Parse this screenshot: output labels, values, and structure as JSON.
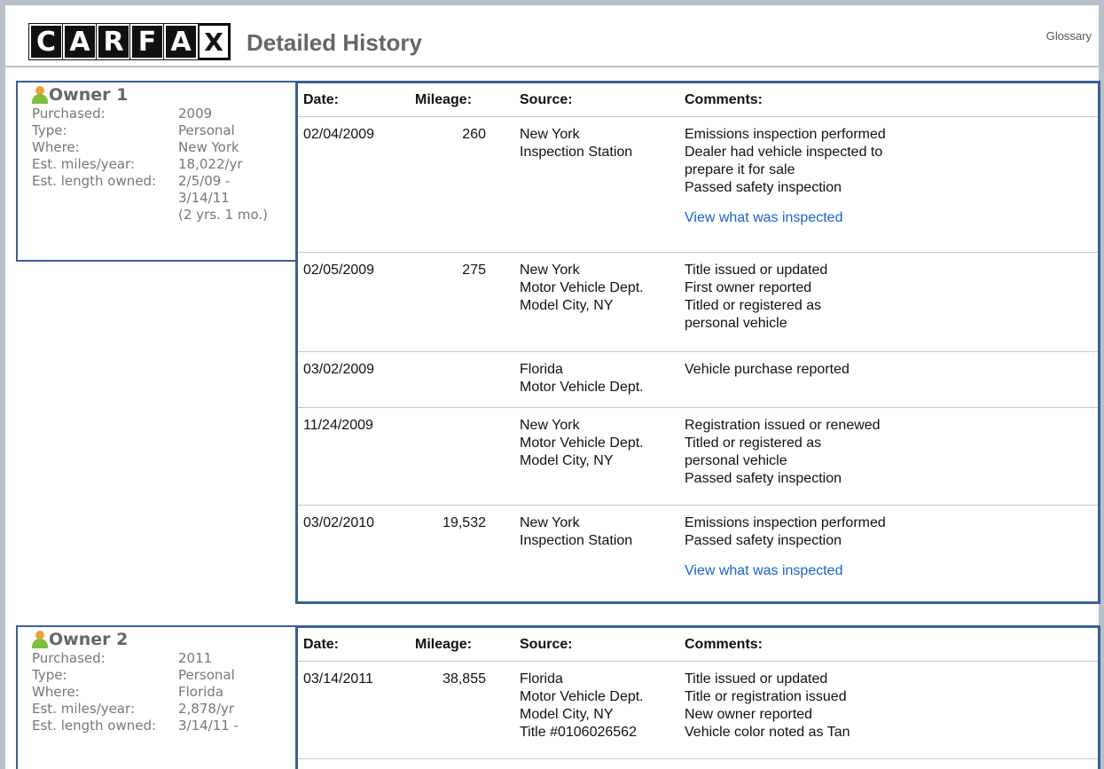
{
  "header": {
    "logo_letters": [
      "C",
      "A",
      "R",
      "F",
      "A",
      "X"
    ],
    "title": "Detailed History",
    "glossary_label": "Glossary"
  },
  "table_headers": {
    "date": "Date:",
    "mileage": "Mileage:",
    "source": "Source:",
    "comments": "Comments:"
  },
  "owners": [
    {
      "heading": "Owner 1",
      "fields": [
        {
          "label": "Purchased:",
          "value": "2009"
        },
        {
          "label": "Type:",
          "value": "Personal"
        },
        {
          "label": "Where:",
          "value": "New York"
        },
        {
          "label": "Est. miles/year:",
          "value": "18,022/yr"
        },
        {
          "label": "Est. length owned:",
          "value": "2/5/09 -"
        }
      ],
      "length_cont": [
        "3/14/11",
        "(2 yrs. 1 mo.)"
      ],
      "records": [
        {
          "date": "02/04/2009",
          "mileage": "260",
          "source": [
            "New York",
            "Inspection Station"
          ],
          "comments": [
            "Emissions inspection performed",
            "Dealer had vehicle inspected to",
            "prepare it for sale",
            "Passed safety inspection"
          ],
          "link": "View what was inspected"
        },
        {
          "date": "02/05/2009",
          "mileage": "275",
          "source": [
            "New York",
            "Motor Vehicle Dept.",
            "Model City, NY"
          ],
          "comments": [
            "Title issued or updated",
            "First owner reported",
            "Titled or registered as",
            "personal vehicle"
          ]
        },
        {
          "date": "03/02/2009",
          "mileage": "",
          "source": [
            "Florida",
            "Motor Vehicle Dept."
          ],
          "comments": [
            "Vehicle purchase reported"
          ]
        },
        {
          "date": "11/24/2009",
          "mileage": "",
          "source": [
            "New York",
            "Motor Vehicle Dept.",
            "Model City, NY"
          ],
          "comments": [
            "Registration issued or renewed",
            "Titled or registered as",
            "personal vehicle",
            "Passed safety inspection"
          ]
        },
        {
          "date": "03/02/2010",
          "mileage": "19,532",
          "source": [
            "New York",
            "Inspection Station"
          ],
          "comments": [
            "Emissions inspection performed",
            "Passed safety inspection"
          ],
          "link": "View what was inspected"
        }
      ]
    },
    {
      "heading": "Owner 2",
      "fields": [
        {
          "label": "Purchased:",
          "value": "2011"
        },
        {
          "label": "Type:",
          "value": "Personal"
        },
        {
          "label": "Where:",
          "value": "Florida"
        },
        {
          "label": "Est. miles/year:",
          "value": "2,878/yr"
        },
        {
          "label": "Est. length owned:",
          "value": "3/14/11 -"
        }
      ],
      "length_cont": [],
      "records": [
        {
          "date": "03/14/2011",
          "mileage": "38,855",
          "source": [
            "Florida",
            "Motor Vehicle Dept.",
            "Model City, NY",
            "Title #0106026562"
          ],
          "comments": [
            "Title issued or updated",
            "Title or registration issued",
            "New owner reported",
            "Vehicle color noted as Tan"
          ]
        }
      ]
    }
  ]
}
